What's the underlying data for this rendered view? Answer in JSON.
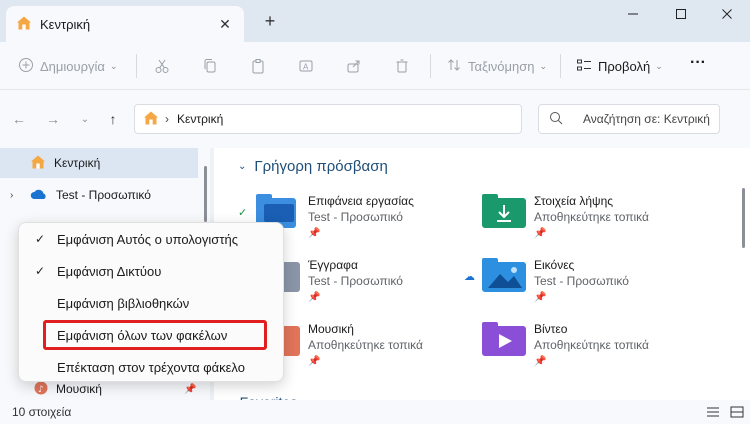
{
  "window": {
    "tab_title": "Κεντρική",
    "icons": {
      "home": "home-icon",
      "close": "close-icon",
      "new_tab": "plus-icon",
      "minimize": "minimize-icon",
      "maximize": "maximize-icon",
      "window_close": "window-close-icon"
    }
  },
  "toolbar": {
    "new_label": "Δημιουργία",
    "sort_label": "Ταξινόμηση",
    "view_label": "Προβολή",
    "more_label": "···"
  },
  "address": {
    "path": "Κεντρική",
    "search_placeholder": "Αναζήτηση σε: Κεντρική"
  },
  "nav": {
    "items": [
      {
        "label": "Κεντρική",
        "icon": "home-icon",
        "selected": true
      },
      {
        "label": "Test - Προσωπικό",
        "icon": "onedrive-cloud-icon",
        "selected": false
      },
      {
        "label": "Μουσική",
        "icon": "music-icon",
        "selected": false
      }
    ]
  },
  "content": {
    "section_title": "Γρήγορη πρόσβαση",
    "favorites_title": "Favorites",
    "quick_access": [
      {
        "name": "Επιφάνεια εργασίας",
        "sub": "Test - Προσωπικό",
        "icon": "desktop-folder-icon",
        "color": "#2f7fd6"
      },
      {
        "name": "Στοιχεία λήψης",
        "sub": "Αποθηκεύτηκε τοπικά",
        "icon": "downloads-folder-icon",
        "color": "#1a9a6c"
      },
      {
        "name": "Έγγραφα",
        "sub": "Test - Προσωπικό",
        "icon": "documents-folder-icon",
        "color": "#8a96a8"
      },
      {
        "name": "Εικόνες",
        "sub": "Test - Προσωπικό",
        "icon": "pictures-folder-icon",
        "color": "#2c8fe0"
      },
      {
        "name": "Μουσική",
        "sub": "Αποθηκεύτηκε τοπικά",
        "icon": "music-folder-icon",
        "color": "#e2745a"
      },
      {
        "name": "Βίντεο",
        "sub": "Αποθηκεύτηκε τοπικά",
        "icon": "videos-folder-icon",
        "color": "#8a4fd6"
      }
    ]
  },
  "status": {
    "count_text": "10 στοιχεία"
  },
  "context_menu": {
    "items": [
      {
        "label": "Εμφάνιση Αυτός ο υπολογιστής",
        "checked": true
      },
      {
        "label": "Εμφάνιση Δικτύου",
        "checked": true
      },
      {
        "label": "Εμφάνιση βιβλιοθηκών",
        "checked": false
      },
      {
        "label": "Εμφάνιση όλων των φακέλων",
        "checked": false
      },
      {
        "label": "Επέκταση στον τρέχοντα φάκελο",
        "checked": false
      }
    ],
    "check_mark": "✓"
  },
  "colors": {
    "accent": "#1f4e79",
    "highlight_border": "#e02020",
    "selection": "#dce6f2"
  }
}
